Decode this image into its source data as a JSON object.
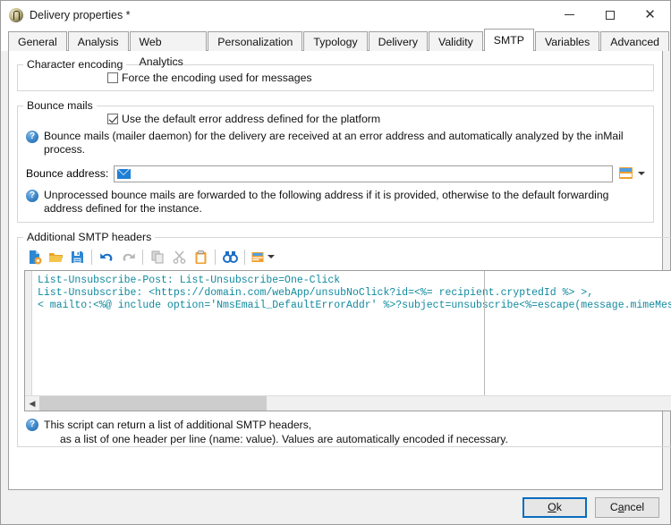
{
  "window": {
    "title": "Delivery properties *",
    "icon": "delivery-properties-icon",
    "minimize": "minimize-icon",
    "maximize": "maximize-icon",
    "close": "close-icon"
  },
  "tabs": [
    {
      "label": "General",
      "active": false
    },
    {
      "label": "Analysis",
      "active": false
    },
    {
      "label": "Web Analytics",
      "active": false
    },
    {
      "label": "Personalization",
      "active": false
    },
    {
      "label": "Typology",
      "active": false
    },
    {
      "label": "Delivery",
      "active": false
    },
    {
      "label": "Validity",
      "active": false
    },
    {
      "label": "SMTP",
      "active": true
    },
    {
      "label": "Variables",
      "active": false
    },
    {
      "label": "Advanced",
      "active": false
    }
  ],
  "character_encoding": {
    "legend": "Character encoding",
    "force_encoding_label": "Force the encoding used for messages",
    "force_encoding_checked": false
  },
  "bounce_mails": {
    "legend": "Bounce mails",
    "use_default_label": "Use the default error address defined for the platform",
    "use_default_checked": true,
    "info_1": "Bounce mails (mailer daemon) for the delivery are received at an error address and automatically analyzed by the inMail process.",
    "address_label": "Bounce address:",
    "address_value": "",
    "address_placeholder": "",
    "info_2": "Unprocessed bounce mails are forwarded to the following address if it is provided, otherwise to the default forwarding address defined for the instance."
  },
  "smtp_headers": {
    "legend": "Additional SMTP headers",
    "toolbar": [
      {
        "name": "new-script-icon",
        "enabled": true
      },
      {
        "name": "open-folder-icon",
        "enabled": true
      },
      {
        "name": "save-icon",
        "enabled": true
      },
      {
        "name": "undo-icon",
        "enabled": true
      },
      {
        "name": "redo-icon",
        "enabled": false
      },
      {
        "name": "copy-icon",
        "enabled": false
      },
      {
        "name": "cut-icon",
        "enabled": false
      },
      {
        "name": "paste-icon",
        "enabled": true
      },
      {
        "name": "find-icon",
        "enabled": true
      },
      {
        "name": "insert-field-icon",
        "enabled": true
      }
    ],
    "code_lines": [
      "List-Unsubscribe-Post: List-Unsubscribe=One-Click",
      "List-Unsubscribe: <https://domain.com/webApp/unsubNoClick?id=<%= recipient.cryptedId %> >,",
      "< mailto:<%@ include option='NmsEmail_DefaultErrorAddr' %>?subject=unsubscribe<%=escape(message.mimeMessag"
    ],
    "help_line_1": "This script can return a list of additional SMTP headers,",
    "help_line_2": "as a list of one header per line (name: value). Values are automatically encoded if necessary."
  },
  "footer": {
    "ok_pre": "O",
    "ok_accel": "k",
    "ok_label": "Ok",
    "cancel_pre": "C",
    "cancel_accel": "a",
    "cancel_post": "ncel",
    "cancel_label": "Cancel"
  },
  "colors": {
    "accent": "#0a6cbf",
    "code_teal": "#118a9e",
    "folder_orange": "#f0a030",
    "mail_blue": "#1e7fd4"
  }
}
